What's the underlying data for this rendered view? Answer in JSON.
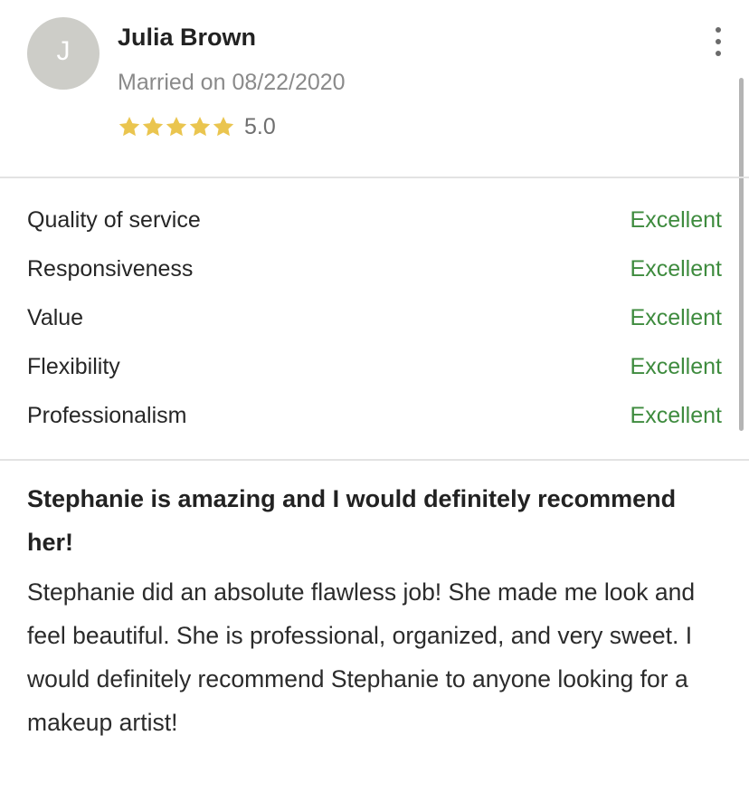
{
  "reviewer": {
    "initial": "J",
    "name": "Julia Brown",
    "married_label": "Married on 08/22/2020",
    "stars": 5,
    "rating_value": "5.0"
  },
  "ratings": [
    {
      "label": "Quality of service",
      "value": "Excellent"
    },
    {
      "label": "Responsiveness",
      "value": "Excellent"
    },
    {
      "label": "Value",
      "value": "Excellent"
    },
    {
      "label": "Flexibility",
      "value": "Excellent"
    },
    {
      "label": "Professionalism",
      "value": "Excellent"
    }
  ],
  "review": {
    "title": "Stephanie is amazing and I would definitely recommend her!",
    "text": "Stephanie did an absolute flawless job! She made me look and feel beautiful. She is professional, organized, and very sweet. I would definitely recommend Stephanie to anyone looking for a makeup artist!"
  },
  "icons": {
    "star": "star-icon",
    "more": "more-vertical-icon"
  },
  "colors": {
    "avatar_bg": "#cdcdc8",
    "star": "#eac54f",
    "excellent": "#3e8b3e",
    "divider": "#e3e3e3"
  }
}
